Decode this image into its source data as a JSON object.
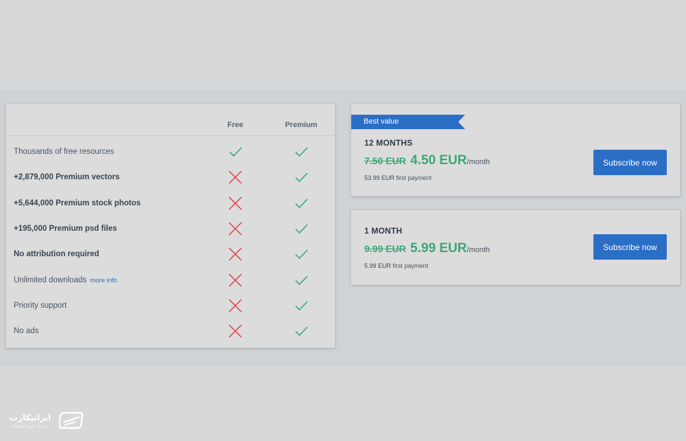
{
  "comparison": {
    "headers": {
      "free": "Free",
      "premium": "Premium"
    },
    "rows": [
      {
        "label": "Thousands of free resources",
        "bold": false,
        "free": true,
        "premium": true
      },
      {
        "label": "+2,879,000 Premium vectors",
        "bold": true,
        "free": false,
        "premium": true
      },
      {
        "label": "+5,644,000 Premium stock photos",
        "bold": true,
        "free": false,
        "premium": true
      },
      {
        "label": "+195,000 Premium psd files",
        "bold": true,
        "free": false,
        "premium": true
      },
      {
        "label": "No attribution required",
        "bold": true,
        "free": false,
        "premium": true
      },
      {
        "label": "Unlimited downloads",
        "bold": false,
        "link": "more info",
        "free": false,
        "premium": true
      },
      {
        "label": "Priority support",
        "bold": false,
        "free": false,
        "premium": true
      },
      {
        "label": "No ads",
        "bold": false,
        "free": false,
        "premium": true
      }
    ],
    "icons": {
      "yes": "check-icon",
      "no": "cross-icon"
    }
  },
  "plans": [
    {
      "ribbon": "Best value",
      "title": "12 MONTHS",
      "old_price": "7.50 EUR",
      "new_price": "4.50 EUR",
      "per": "/month",
      "first_amount": "53.99 EUR",
      "first_label": "first payment",
      "button": "Subscribe now"
    },
    {
      "title": "1 MONTH",
      "old_price": "9.99 EUR",
      "new_price": "5.99 EUR",
      "per": "/month",
      "first_amount": "5.99 EUR",
      "first_label": "first payment",
      "button": "Subscribe now"
    }
  ],
  "watermark": {
    "title": "ایرانیکارت",
    "subtitle": "خرید از خارج با ایرانیکارت",
    "icon": "card-logo-icon"
  },
  "colors": {
    "accent_blue": "#2b6ec6",
    "price_green": "#3aa775",
    "check_green": "#3aa775",
    "cross_red": "#d8545a"
  }
}
